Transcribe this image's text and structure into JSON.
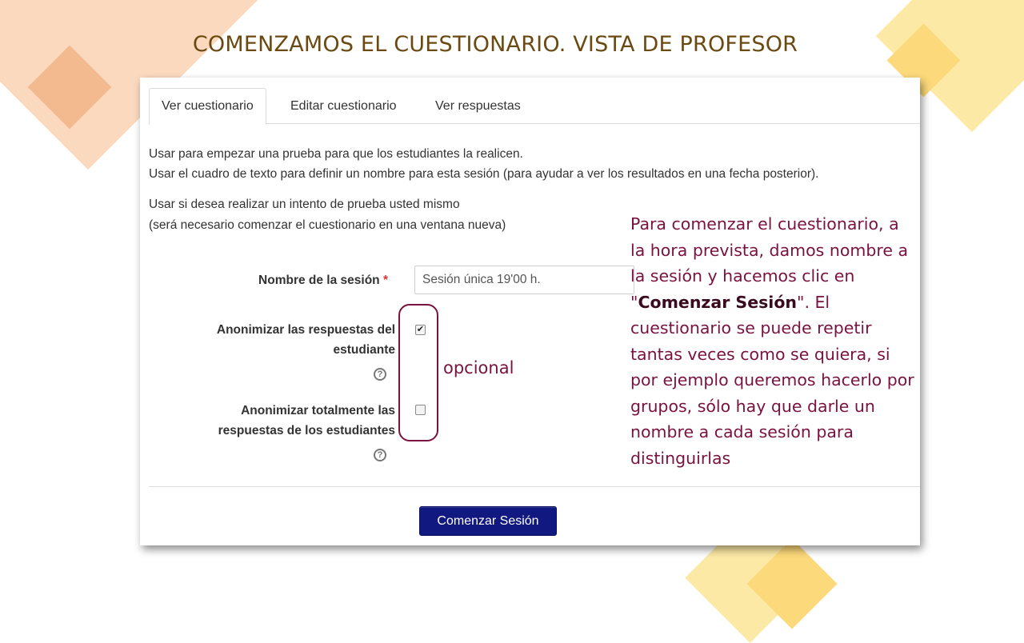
{
  "slide": {
    "title": "COMENZAMOS EL CUESTIONARIO. VISTA DE PROFESOR"
  },
  "tabs": [
    {
      "label": "Ver cuestionario",
      "active": true
    },
    {
      "label": "Editar cuestionario",
      "active": false
    },
    {
      "label": "Ver respuestas",
      "active": false
    }
  ],
  "intro": {
    "line1": "Usar para empezar una prueba para que los estudiantes la realicen.",
    "line2": "Usar el cuadro de texto para definir un nombre para esta sesión (para ayudar a ver los resultados en una fecha posterior).",
    "line3": "Usar si desea realizar un intento de prueba usted mismo",
    "line4": "(será necesario comenzar el cuestionario en una ventana nueva)"
  },
  "form": {
    "session_label": "Nombre de la sesión",
    "required_mark": "*",
    "session_value": "Sesión única 19'00 h.",
    "anon_label_line1": "Anonimizar las respuestas del",
    "anon_label_line2": "estudiante",
    "anon_checked": true,
    "full_anon_label_line1": "Anonimizar totalmente las",
    "full_anon_label_line2": "respuestas de los estudiantes",
    "full_anon_checked": false,
    "help_glyph": "?",
    "check_glyph": "✔",
    "start_button": "Comenzar Sesión"
  },
  "annotation": {
    "opcional": "opcional",
    "note_part1": "Para comenzar el cuestionario, a la hora prevista, damos nombre a la sesión y hacemos clic en \"",
    "note_bold": "Comenzar Sesión",
    "note_part2": "\". El cuestionario se puede repetir tantas veces como se quiera, si por ejemplo queremos hacerlo por grupos, sólo hay que darle un nombre a cada sesión para distinguirlas"
  },
  "colors": {
    "title": "#6b4a12",
    "annotation": "#7a1240",
    "button": "#111880",
    "deco_orange": "#f7c9a4",
    "deco_yellow": "#fde7a0"
  }
}
